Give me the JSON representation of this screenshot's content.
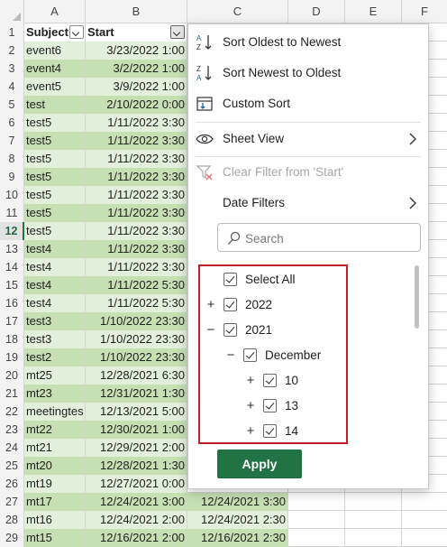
{
  "columns": [
    "A",
    "B",
    "C",
    "D",
    "E",
    "F"
  ],
  "header": {
    "row_number": "1",
    "subject": "Subject",
    "start": "Start"
  },
  "rows": [
    {
      "n": "2",
      "a": "event6",
      "b": "3/23/2022 1:00",
      "c": ""
    },
    {
      "n": "3",
      "a": "event4",
      "b": "3/2/2022 1:00",
      "c": ""
    },
    {
      "n": "4",
      "a": "event5",
      "b": "3/9/2022 1:00",
      "c": ""
    },
    {
      "n": "5",
      "a": "test",
      "b": "2/10/2022 0:00",
      "c": ""
    },
    {
      "n": "6",
      "a": "test5",
      "b": "1/11/2022 3:30",
      "c": ""
    },
    {
      "n": "7",
      "a": "test5",
      "b": "1/11/2022 3:30",
      "c": ""
    },
    {
      "n": "8",
      "a": "test5",
      "b": "1/11/2022 3:30",
      "c": ""
    },
    {
      "n": "9",
      "a": "test5",
      "b": "1/11/2022 3:30",
      "c": ""
    },
    {
      "n": "10",
      "a": "test5",
      "b": "1/11/2022 3:30",
      "c": ""
    },
    {
      "n": "11",
      "a": "test5",
      "b": "1/11/2022 3:30",
      "c": ""
    },
    {
      "n": "12",
      "a": "test5",
      "b": "1/11/2022 3:30",
      "c": ""
    },
    {
      "n": "13",
      "a": "test4",
      "b": "1/11/2022 3:30",
      "c": ""
    },
    {
      "n": "14",
      "a": "test4",
      "b": "1/11/2022 3:30",
      "c": ""
    },
    {
      "n": "15",
      "a": "test4",
      "b": "1/11/2022 5:30",
      "c": ""
    },
    {
      "n": "16",
      "a": "test4",
      "b": "1/11/2022 5:30",
      "c": ""
    },
    {
      "n": "17",
      "a": "test3",
      "b": "1/10/2022 23:30",
      "c": ""
    },
    {
      "n": "18",
      "a": "test3",
      "b": "1/10/2022 23:30",
      "c": ""
    },
    {
      "n": "19",
      "a": "test2",
      "b": "1/10/2022 23:30",
      "c": ""
    },
    {
      "n": "20",
      "a": "mt25",
      "b": "12/28/2021 6:30",
      "c": ""
    },
    {
      "n": "21",
      "a": "mt23",
      "b": "12/31/2021 1:30",
      "c": ""
    },
    {
      "n": "22",
      "a": "meetingtes",
      "b": "12/13/2021 5:00",
      "c": ""
    },
    {
      "n": "23",
      "a": "mt22",
      "b": "12/30/2021 1:00",
      "c": ""
    },
    {
      "n": "24",
      "a": "mt21",
      "b": "12/29/2021 2:00",
      "c": ""
    },
    {
      "n": "25",
      "a": "mt20",
      "b": "12/28/2021 1:30",
      "c": ""
    },
    {
      "n": "26",
      "a": "mt19",
      "b": "12/27/2021 0:00",
      "c": ""
    },
    {
      "n": "27",
      "a": "mt17",
      "b": "12/24/2021 3:00",
      "c": "12/24/2021 3:30"
    },
    {
      "n": "28",
      "a": "mt16",
      "b": "12/24/2021 2:00",
      "c": "12/24/2021 2:30"
    },
    {
      "n": "29",
      "a": "mt15",
      "b": "12/16/2021 2:00",
      "c": "12/16/2021 2:30"
    }
  ],
  "menu": {
    "sort_asc": "Sort Oldest to Newest",
    "sort_desc": "Sort Newest to Oldest",
    "custom_sort": "Custom Sort",
    "sheet_view": "Sheet View",
    "clear_filter": "Clear Filter from 'Start'",
    "date_filters": "Date Filters",
    "search_placeholder": "Search",
    "apply": "Apply"
  },
  "tree": [
    {
      "label": "Select All",
      "level": 0,
      "expander": "",
      "checked": true
    },
    {
      "label": "2022",
      "level": 0,
      "expander": "+",
      "checked": true
    },
    {
      "label": "2021",
      "level": 0,
      "expander": "−",
      "checked": true
    },
    {
      "label": "December",
      "level": 1,
      "expander": "−",
      "checked": true
    },
    {
      "label": "10",
      "level": 2,
      "expander": "+",
      "checked": true
    },
    {
      "label": "13",
      "level": 2,
      "expander": "+",
      "checked": true
    },
    {
      "label": "14",
      "level": 2,
      "expander": "+",
      "checked": true
    }
  ],
  "colors": {
    "accent": "#217346",
    "fill_dark": "#c6e0b4",
    "fill_light": "#e2efda",
    "highlight_border": "#c0202c"
  }
}
